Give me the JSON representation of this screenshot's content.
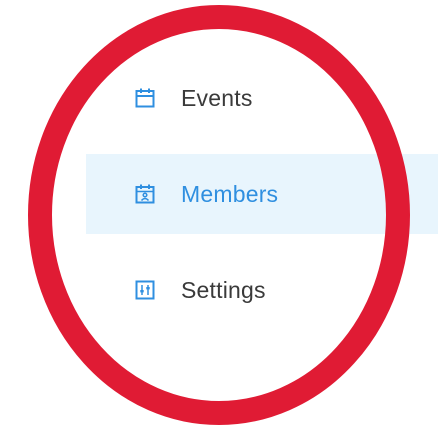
{
  "sidebar": {
    "items": [
      {
        "label": "Events",
        "icon": "calendar-icon",
        "active": false
      },
      {
        "label": "Members",
        "icon": "calendar-user-icon",
        "active": true
      },
      {
        "label": "Settings",
        "icon": "sliders-icon",
        "active": false
      }
    ]
  },
  "colors": {
    "accent": "#2f8fe0",
    "active_bg": "#e8f5fd",
    "text": "#3a3a3a",
    "annotation": "#e01b34"
  }
}
